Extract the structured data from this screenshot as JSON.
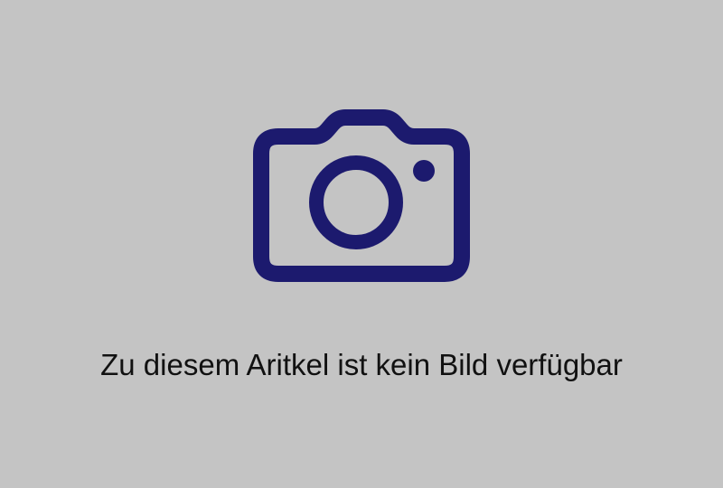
{
  "placeholder": {
    "message": "Zu diesem Aritkel ist kein Bild verfügbar",
    "icon": "camera-icon"
  },
  "colors": {
    "background": "#c4c4c4",
    "icon": "#1c1a6e",
    "text": "#111111"
  }
}
